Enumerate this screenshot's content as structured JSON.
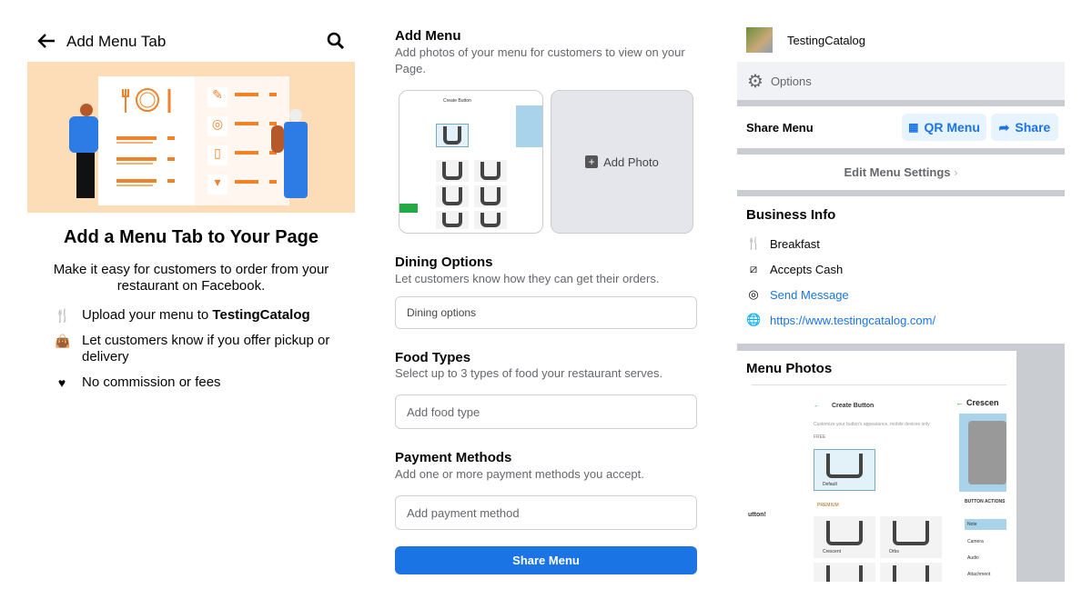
{
  "left": {
    "header": {
      "title": "Add Menu Tab",
      "back_icon": "arrow-left-icon",
      "search_icon": "search-icon"
    },
    "title": "Add a Menu Tab to Your Page",
    "subtitle": "Make it easy for customers to order from your restaurant on Facebook.",
    "features": [
      {
        "icon": "utensils-icon",
        "text": "Upload your menu to ",
        "bold": "TestingCatalog"
      },
      {
        "icon": "shopping-bag-icon",
        "text": "Let customers know if you offer pickup or delivery"
      },
      {
        "icon": "heart-icon",
        "text": "No commission or fees"
      }
    ],
    "illustration_color": "#fddcb8"
  },
  "middle": {
    "add_menu": {
      "title": "Add Menu",
      "description": "Add photos of your menu for customers to view on your Page.",
      "add_photo": "Add Photo"
    },
    "dining": {
      "title": "Dining Options",
      "description": "Let customers know how they can get their orders.",
      "placeholder": "Dining options"
    },
    "food": {
      "title": "Food Types",
      "description": "Select up to 3 types of food your restaurant serves.",
      "placeholder": "Add food type"
    },
    "payment": {
      "title": "Payment Methods",
      "description": "Add one or more payment methods you accept.",
      "placeholder": "Add payment method"
    },
    "share_button": "Share Menu",
    "accent": "#1b74e4"
  },
  "right": {
    "page_name": "TestingCatalog",
    "options": "Options",
    "share_menu": {
      "label": "Share Menu",
      "qr": "QR Menu",
      "share": "Share"
    },
    "edit_settings": "Edit Menu Settings",
    "business_info": {
      "title": "Business Info",
      "items": [
        {
          "icon": "utensils-icon",
          "text": "Breakfast"
        },
        {
          "icon": "cash-icon",
          "text": "Accepts Cash"
        },
        {
          "icon": "messenger-icon",
          "text": "Send Message"
        },
        {
          "icon": "globe-icon",
          "text": "https://www.testingcatalog.com/"
        }
      ]
    },
    "menu_photos": {
      "title": "Menu Photos",
      "photo": {
        "title": "Create Button",
        "subtitle": "Customize your button's appearance, mobile devices only",
        "free": "FREE",
        "default": "Default",
        "premium": "PREMIUM",
        "crescent": "Crescent",
        "orbs": "Orbs",
        "side_title": "Crescen",
        "actions_title": "BUTTON ACTIONS",
        "actions": [
          "Note",
          "Camera",
          "Audio",
          "Attachment"
        ],
        "left_fragment": "utton!"
      }
    }
  }
}
